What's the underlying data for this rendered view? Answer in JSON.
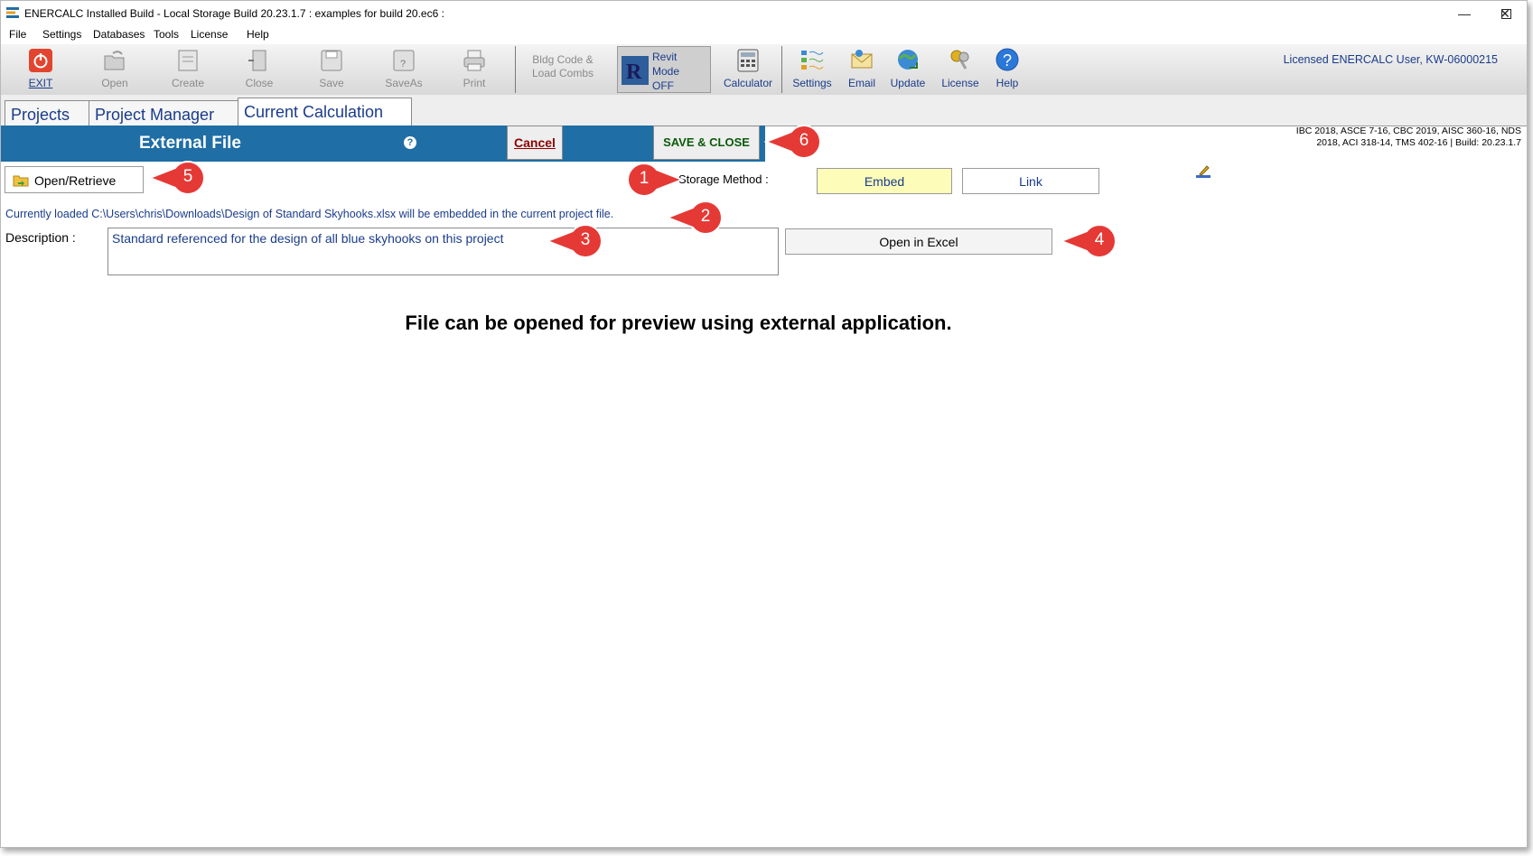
{
  "titlebar": {
    "title": "ENERCALC Installed Build - Local Storage Build 20.23.1.7 :   examples for build 20.ec6 :"
  },
  "menu": [
    "File",
    "Settings",
    "Databases",
    "Tools",
    "License",
    "Help"
  ],
  "toolbar": {
    "exit": "EXIT",
    "open": "Open",
    "create": "Create",
    "close": "Close",
    "save": "Save",
    "saveas": "SaveAs",
    "print": "Print",
    "bldg_code_1": "Bldg Code &",
    "bldg_code_2": "Load Combs",
    "revit_1": "Revit",
    "revit_2": "Mode",
    "revit_3": "OFF",
    "calculator": "Calculator",
    "settings": "Settings",
    "email": "Email",
    "update": "Update",
    "license": "License",
    "help": "Help",
    "license_text": "Licensed ENERCALC User, KW-06000215"
  },
  "tabs": {
    "projects": "Projects",
    "project_manager": "Project Manager",
    "current_calculation": "Current Calculation"
  },
  "header": {
    "title": "External File",
    "help": "?",
    "cancel": "Cancel",
    "save_close": "SAVE & CLOSE",
    "codes_line1": "IBC 2018, ASCE 7-16, CBC 2019, AISC 360-16, NDS",
    "codes_line2": "2018, ACI 318-14, TMS 402-16 | Build: 20.23.1.7"
  },
  "form": {
    "open_retrieve": "Open/Retrieve",
    "storage_label": "Storage Method :",
    "embed": "Embed",
    "link": "Link",
    "loaded_msg": "Currently loaded C:\\Users\\chris\\Downloads\\Design of Standard Skyhooks.xlsx will be embedded in the current project file.",
    "description_label": "Description :",
    "description_value": "Standard referenced for the design of all blue skyhooks on this project",
    "open_in_excel": "Open in Excel",
    "preview_msg": "File can be opened for preview using external application."
  },
  "callouts": [
    "1",
    "2",
    "3",
    "4",
    "5",
    "6"
  ],
  "colors": {
    "header_blue": "#1f6ea5",
    "text_blue": "#1a3c8a",
    "embed_yellow": "#fdfdb9",
    "callout_red": "#e53935"
  }
}
